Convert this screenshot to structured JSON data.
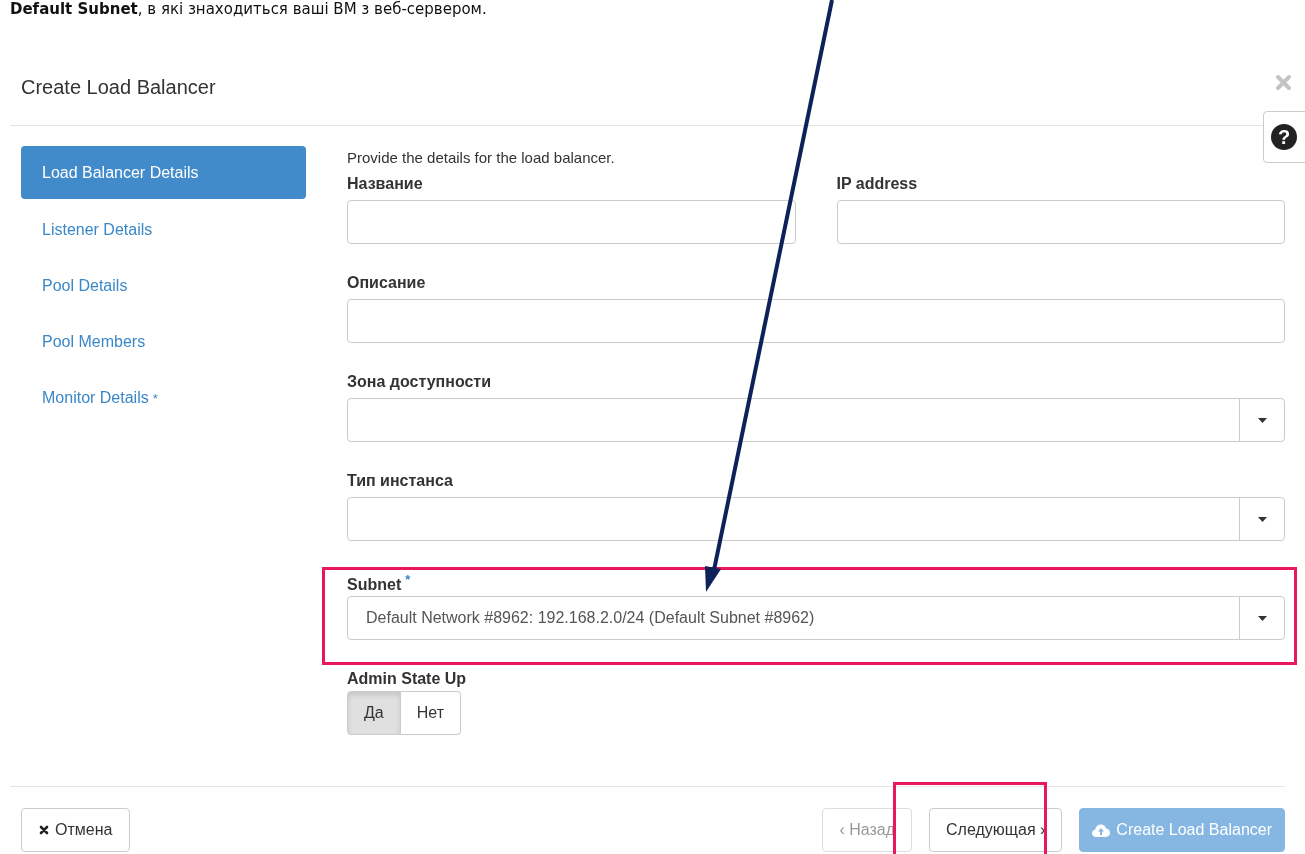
{
  "caption": "**Default Subnet**, в які знаходиться ваші ВМ з веб-сервером.",
  "dialog": {
    "title": "Create Load Balancer",
    "help": "?"
  },
  "steps": [
    {
      "label": "Load Balancer Details",
      "selected": true
    },
    {
      "label": "Listener Details",
      "selected": false
    },
    {
      "label": "Pool Details",
      "selected": false
    },
    {
      "label": "Pool Members",
      "selected": false
    },
    {
      "label": "Monitor Details",
      "selected": false,
      "marker": "*"
    }
  ],
  "intro": "Provide the details for the load balancer.",
  "rows": [
    [
      {
        "kind": "text",
        "label": "Название"
      },
      {
        "kind": "text",
        "label": "IP address"
      }
    ],
    [
      {
        "kind": "text",
        "label": "Описание"
      }
    ],
    [
      {
        "kind": "select",
        "label": "Зона доступности"
      }
    ],
    [
      {
        "kind": "select",
        "label": "Тип инстанса"
      }
    ],
    [
      {
        "kind": "select",
        "label": "Subnet",
        "marker": "*",
        "value": "Default Network #8962: 192.168.2.0/24 (Default Subnet #8962)"
      }
    ],
    [
      {
        "kind": "toggle",
        "label": "Admin State Up",
        "options": [
          {
            "label": "Да",
            "selected": true
          },
          {
            "label": "Нет",
            "selected": false
          }
        ]
      }
    ]
  ],
  "footer": {
    "cancel": "Отмена",
    "back": {
      "label": "‹ Назад",
      "disabled": true
    },
    "next": {
      "label": "Следующая ›",
      "disabled": false
    },
    "create": {
      "label": "Create Load Balancer",
      "disabled": true
    }
  }
}
